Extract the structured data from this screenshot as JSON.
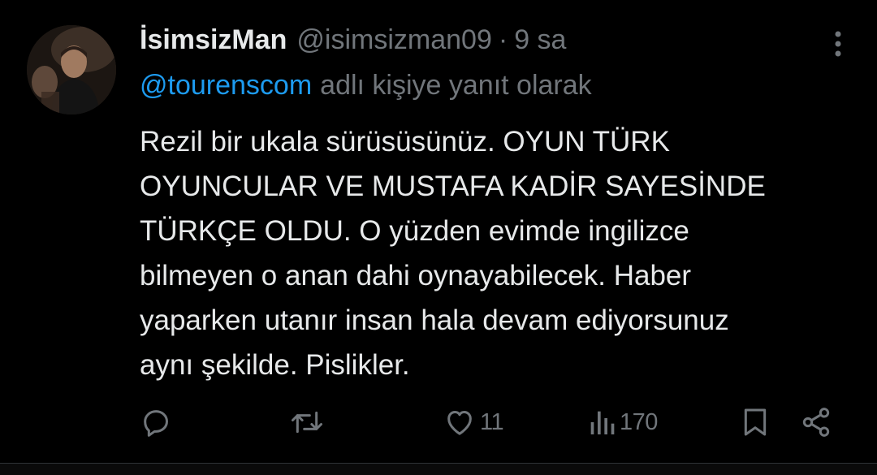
{
  "tweet": {
    "display_name": "İsimsizMan",
    "handle": "@isimsizman09",
    "separator": "·",
    "time": "9 sa",
    "reply_to_handle": "@tourenscom",
    "reply_to_text": "adlı kişiye yanıt olarak",
    "text_lines": [
      "Rezil bir ukala sürüsüsünüz. OYUN TÜRK",
      "OYUNCULAR VE MUSTAFA KADİR SAYESİNDE",
      "TÜRKÇE OLDU. O yüzden evimde ingilizce",
      "bilmeyen o anan dahi oynayabilecek. Haber",
      "yaparken utanır insan hala devam ediyorsunuz",
      "aynı şekilde. Pislikler."
    ]
  },
  "actions": {
    "reply": {
      "icon": "reply-icon",
      "count": ""
    },
    "retweet": {
      "icon": "retweet-icon",
      "count": ""
    },
    "like": {
      "icon": "heart-icon",
      "count": "11"
    },
    "views": {
      "icon": "views-icon",
      "count": "170"
    },
    "bookmark": {
      "icon": "bookmark-icon"
    },
    "share": {
      "icon": "share-icon"
    }
  },
  "colors": {
    "background": "#000000",
    "text": "#e7e9ea",
    "muted": "#71767b",
    "accent": "#1d9bf0"
  }
}
